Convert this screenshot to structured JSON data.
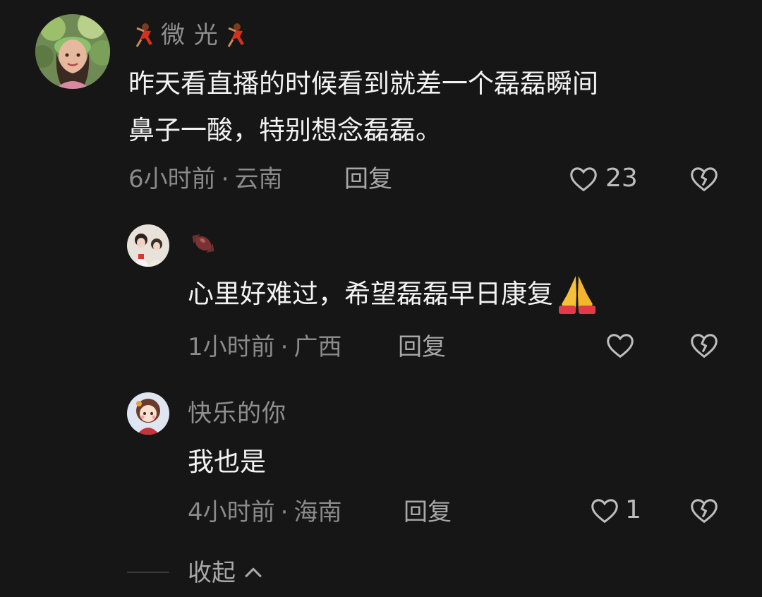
{
  "comments": [
    {
      "username": "微 光",
      "text_line1": "昨天看直播的时候看到就差一个磊磊瞬间",
      "text_line2": "鼻子一酸，特别想念磊磊。",
      "time": "6小时前",
      "location": "云南",
      "reply_label": "回复",
      "likes": "23",
      "username_icon": "dancer-emoji-icon"
    }
  ],
  "replies": [
    {
      "username_icon": "candy-emoji-icon",
      "text": "心里好难过，希望磊磊早日康复",
      "text_emoji": "folded-hands-emoji",
      "time": "1小时前",
      "location": "广西",
      "reply_label": "回复",
      "likes": ""
    },
    {
      "username": "快乐的你",
      "text": "我也是",
      "time": "4小时前",
      "location": "海南",
      "reply_label": "回复",
      "likes": "1"
    }
  ],
  "meta_separator": "·",
  "collapse_label": "收起",
  "colors": {
    "background": "#161616",
    "primary_text": "#f2f2f2",
    "secondary_text": "#8a8a8a"
  }
}
